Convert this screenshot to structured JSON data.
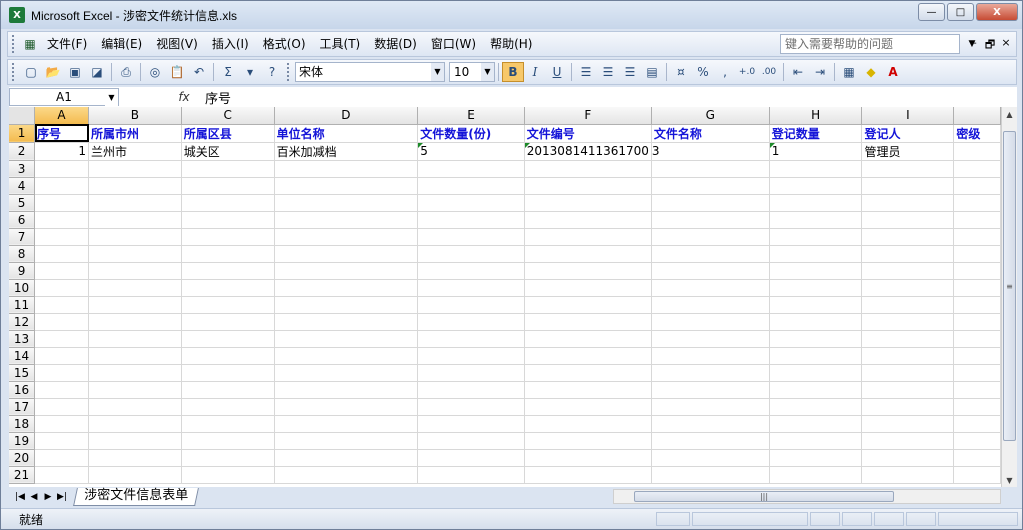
{
  "window": {
    "app_name": "Microsoft Excel",
    "title": "Microsoft Excel - 涉密文件统计信息.xls",
    "buttons": {
      "minimize": "—",
      "restore": "□",
      "close": "X"
    }
  },
  "menubar": {
    "items": [
      "文件(F)",
      "编辑(E)",
      "视图(V)",
      "插入(I)",
      "格式(O)",
      "工具(T)",
      "数据(D)",
      "窗口(W)",
      "帮助(H)"
    ],
    "help_placeholder": "键入需要帮助的问题",
    "mdi_buttons": {
      "minimize": "–",
      "restore": "🗗",
      "close": "×"
    }
  },
  "toolbar": {
    "font_name": "宋体",
    "font_size": "10",
    "bold": "B",
    "italic": "I",
    "underline": "U",
    "sum": "Σ",
    "percent": "%",
    "comma": ",",
    "inc_decimal": "+.0",
    "dec_decimal": ".00"
  },
  "formula_bar": {
    "name_box": "A1",
    "fx": "fx",
    "value": "序号"
  },
  "sheet": {
    "columns": [
      "A",
      "B",
      "C",
      "D",
      "E",
      "F",
      "G",
      "H",
      "I",
      ""
    ],
    "row_numbers": [
      "1",
      "2",
      "3",
      "4",
      "5",
      "6",
      "7",
      "8",
      "9",
      "10",
      "11",
      "12",
      "13",
      "14",
      "15",
      "16",
      "17",
      "18",
      "19",
      "20",
      "21"
    ],
    "header_row": [
      "序号",
      "所属市州",
      "所属区县",
      "单位名称",
      "文件数量(份)",
      "文件编号",
      "文件名称",
      "登记数量",
      "登记人",
      "密级"
    ],
    "data_rows": [
      [
        "1",
        "兰州市",
        "城关区",
        "百米加减档",
        "5",
        "2013081411361700",
        "3",
        "1",
        "管理员",
        ""
      ]
    ]
  },
  "tabs": {
    "nav": [
      "|◀",
      "◀",
      "▶",
      "▶|"
    ],
    "sheet_name": "涉密文件信息表单"
  },
  "status": {
    "text": "就绪"
  }
}
